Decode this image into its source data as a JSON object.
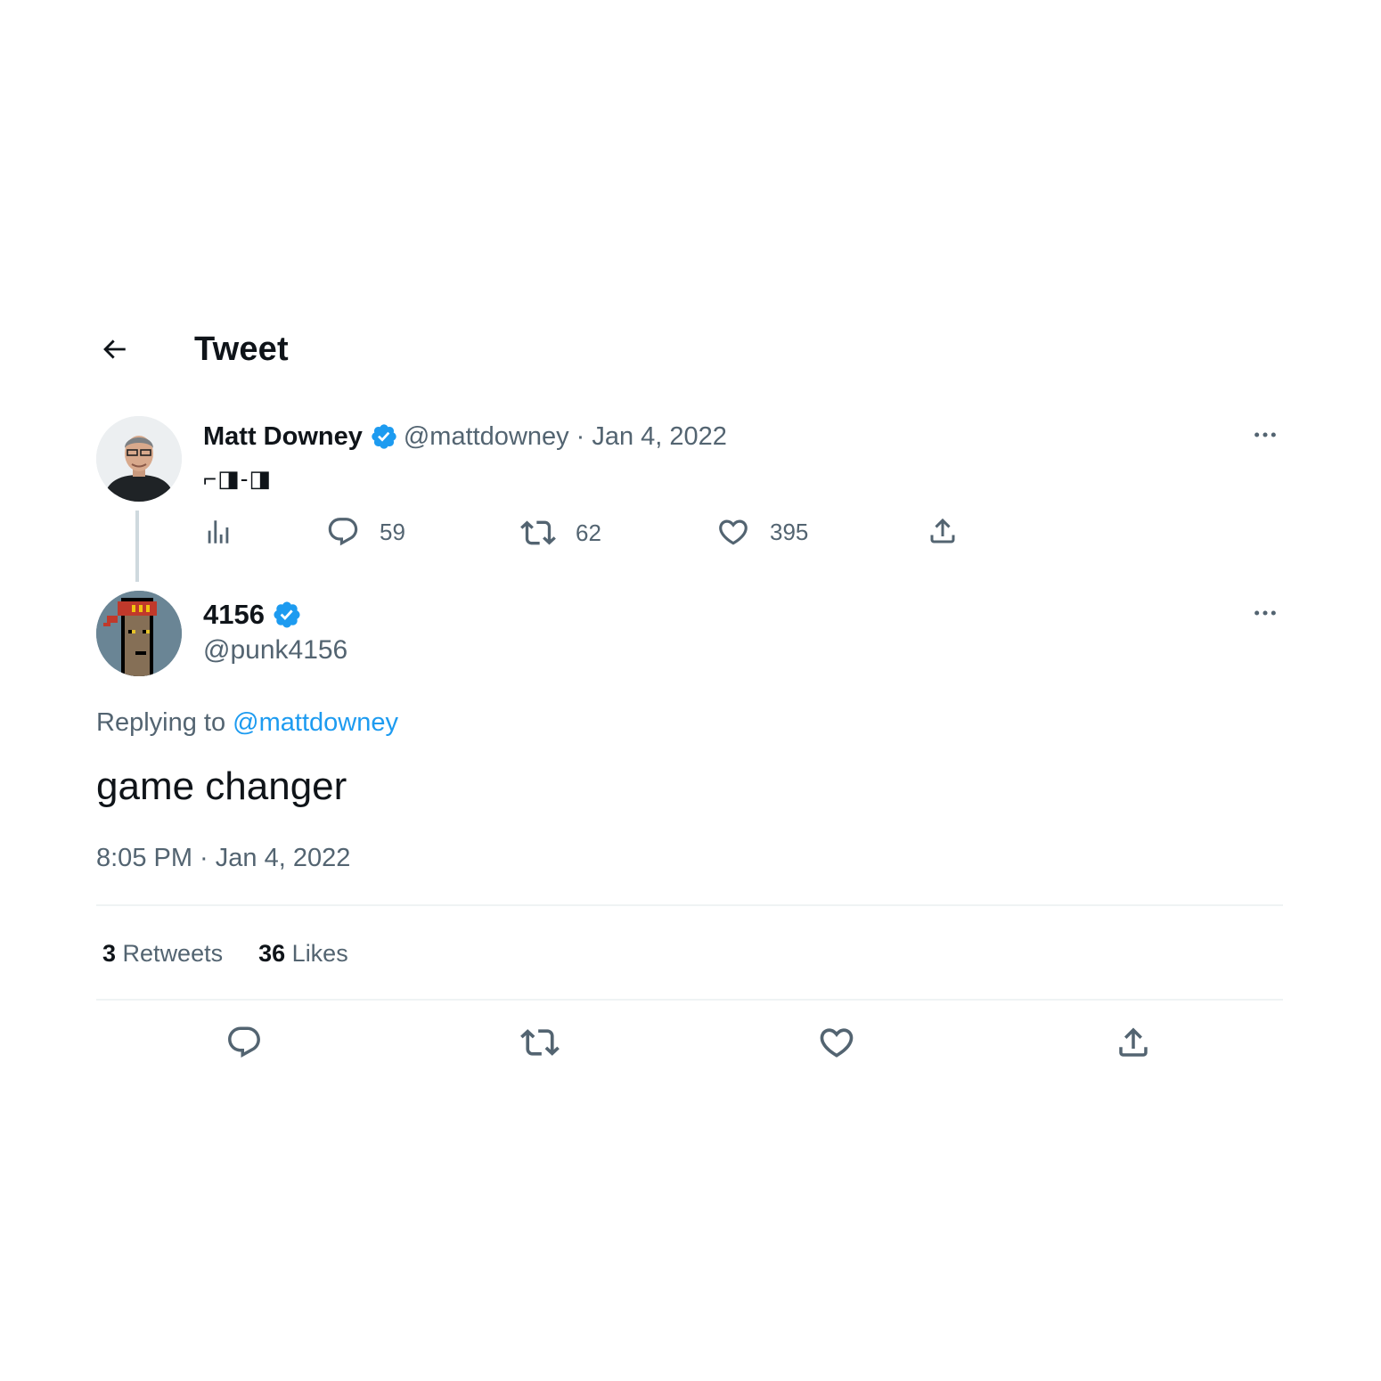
{
  "header": {
    "title": "Tweet"
  },
  "parent_tweet": {
    "name": "Matt Downey",
    "handle": "@mattdowney",
    "separator": "·",
    "date": "Jan 4, 2022",
    "text": "⌐◨-◨",
    "replies": "59",
    "retweets": "62",
    "likes": "395"
  },
  "tweet": {
    "name": "4156",
    "handle": "@punk4156",
    "replying_prefix": "Replying to",
    "replying_to": "@mattdowney",
    "text": "game changer",
    "timestamp": "8:05 PM · Jan 4, 2022",
    "retweet_count": "3",
    "retweet_label": "Retweets",
    "like_count": "36",
    "like_label": "Likes"
  },
  "colors": {
    "accent": "#1d9bf0",
    "text": "#0f1419",
    "muted": "#536471",
    "divider": "#eff3f4"
  },
  "icons": [
    "back-arrow-icon",
    "verified-badge-icon",
    "more-icon",
    "views-icon",
    "reply-icon",
    "retweet-icon",
    "like-icon",
    "share-icon"
  ]
}
